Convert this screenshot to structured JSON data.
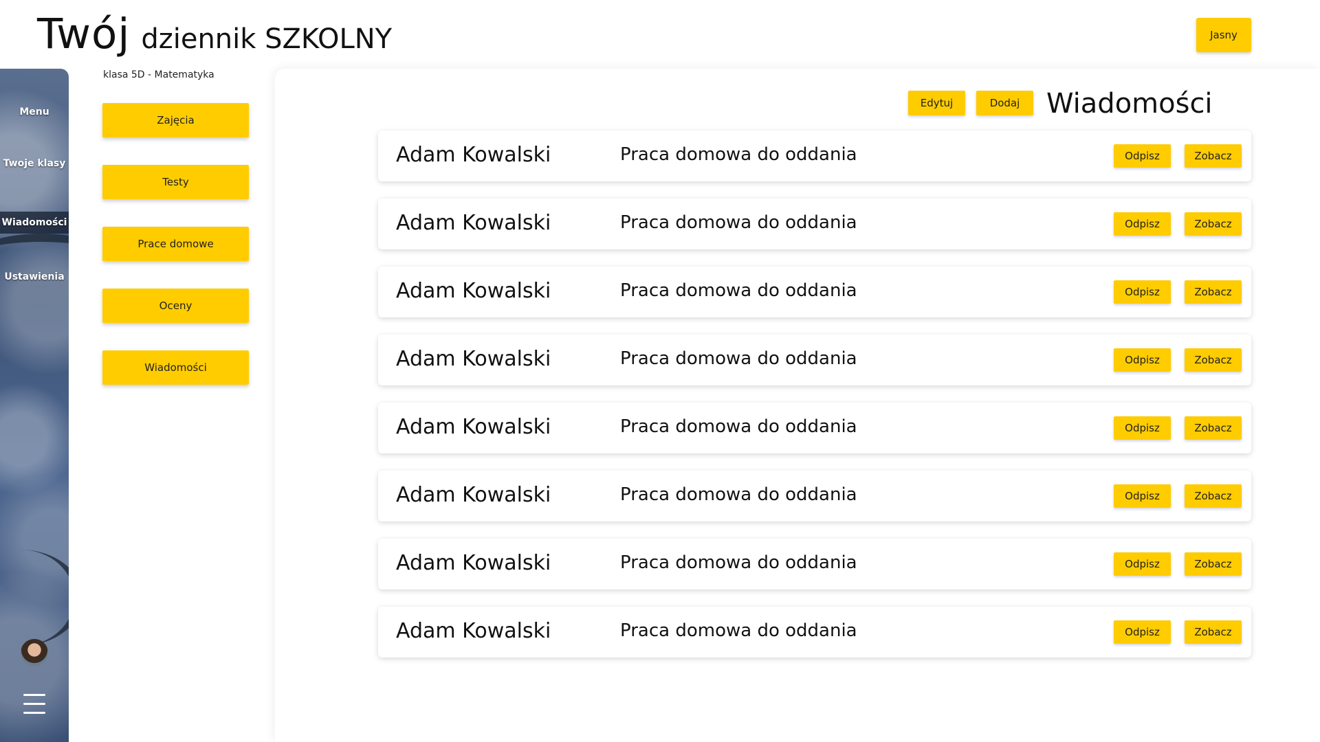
{
  "header": {
    "logo_big": "Twój",
    "logo_small": "dziennik SZKOLNY",
    "theme_button": "Jasny"
  },
  "rail": {
    "items": [
      {
        "label": "Menu"
      },
      {
        "label": "Twoje klasy"
      },
      {
        "label": "Wiadomości",
        "active": true
      },
      {
        "label": "Ustawienia"
      }
    ]
  },
  "class_panel": {
    "title": "klasa 5D - Matematyka",
    "buttons": [
      "Zajęcia",
      "Testy",
      "Prace domowe",
      "Oceny",
      "Wiadomości"
    ]
  },
  "main": {
    "title": "Wiadomości",
    "edit_label": "Edytuj",
    "add_label": "Dodaj",
    "reply_label": "Odpisz",
    "view_label": "Zobacz",
    "messages": [
      {
        "sender": "Adam Kowalski",
        "subject": "Praca domowa do oddania"
      },
      {
        "sender": "Adam Kowalski",
        "subject": "Praca domowa do oddania"
      },
      {
        "sender": "Adam Kowalski",
        "subject": "Praca domowa do oddania"
      },
      {
        "sender": "Adam Kowalski",
        "subject": "Praca domowa do oddania"
      },
      {
        "sender": "Adam Kowalski",
        "subject": "Praca domowa do oddania"
      },
      {
        "sender": "Adam Kowalski",
        "subject": "Praca domowa do oddania"
      },
      {
        "sender": "Adam Kowalski",
        "subject": "Praca domowa do oddania"
      },
      {
        "sender": "Adam Kowalski",
        "subject": "Praca domowa do oddania"
      }
    ]
  },
  "colors": {
    "accent": "#FFCC00",
    "text": "#111111",
    "rail_active": "#1f2a38"
  }
}
